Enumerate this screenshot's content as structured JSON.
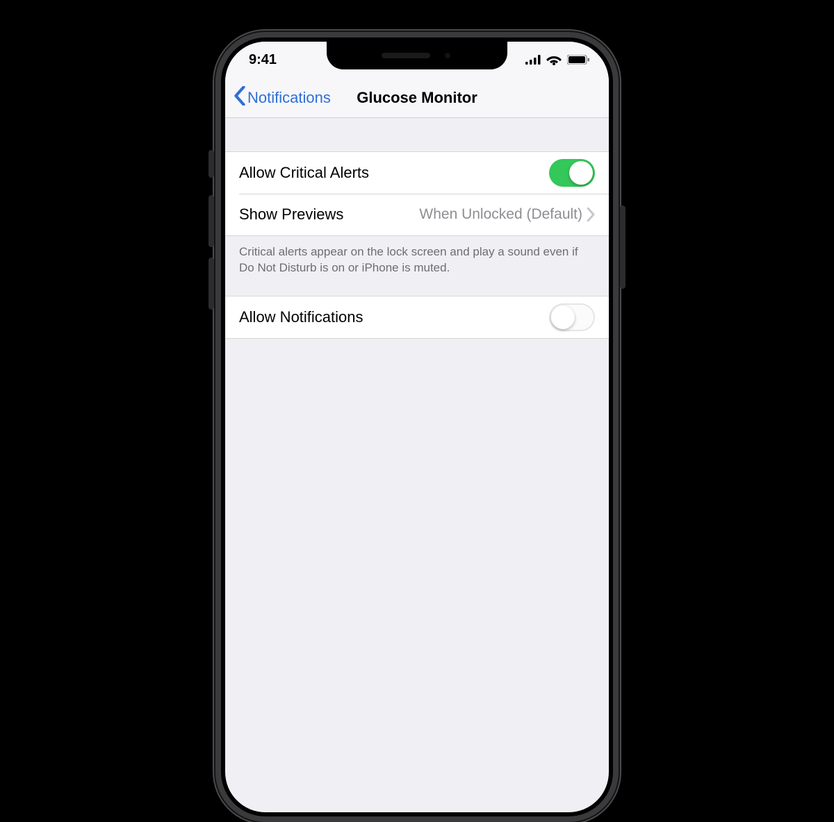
{
  "status": {
    "time": "9:41"
  },
  "nav": {
    "back_label": "Notifications",
    "title": "Glucose Monitor"
  },
  "rows": {
    "critical_alerts": {
      "label": "Allow Critical Alerts",
      "on": true
    },
    "show_previews": {
      "label": "Show Previews",
      "value": "When Unlocked (Default)"
    },
    "allow_notifications": {
      "label": "Allow Notifications",
      "on": false
    }
  },
  "footer": "Critical alerts appear on the lock screen and play a sound even if Do Not Disturb is on or iPhone is muted.",
  "colors": {
    "accent_blue": "#2f6fd7",
    "toggle_green": "#34c759",
    "bg": "#efeff4"
  }
}
